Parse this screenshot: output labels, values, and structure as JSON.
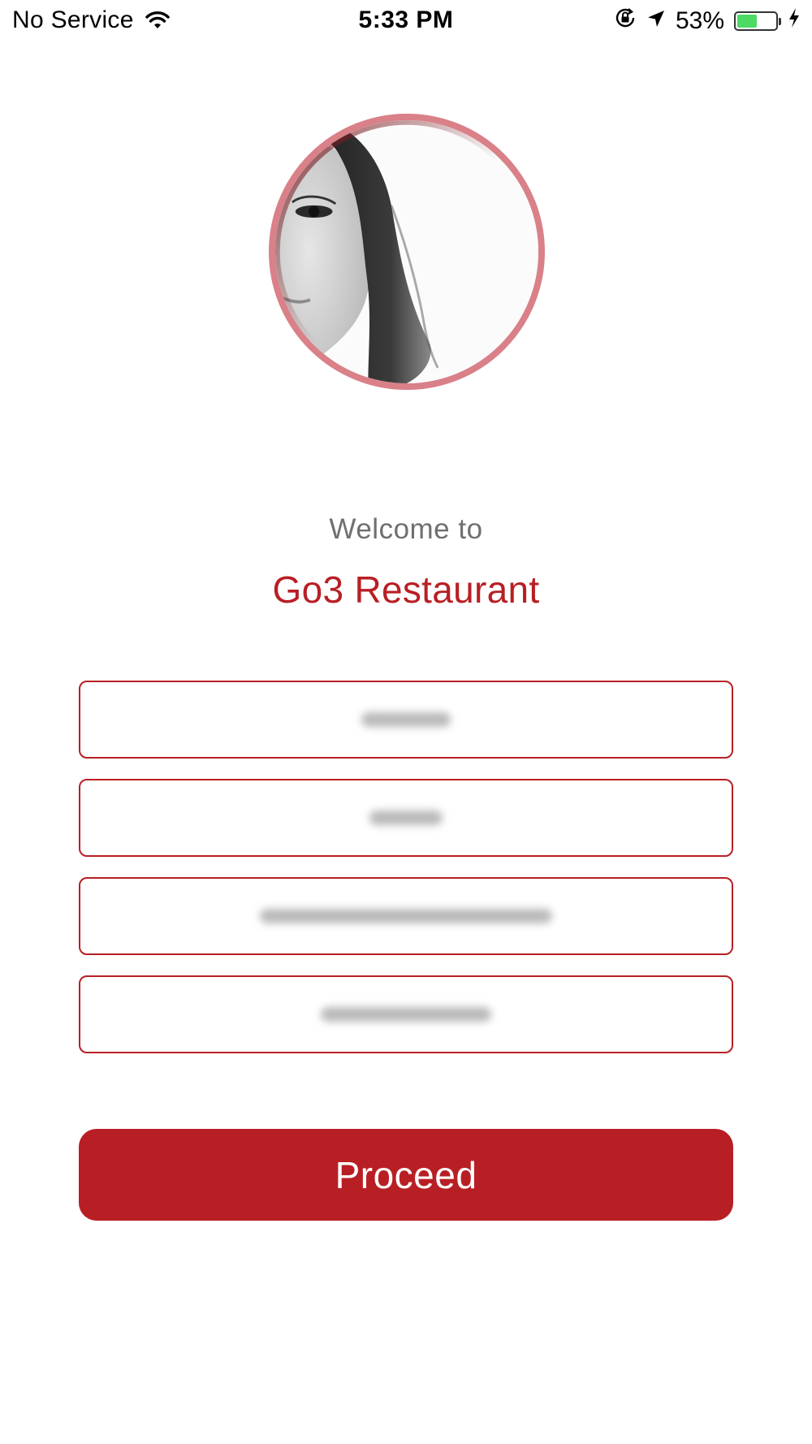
{
  "status_bar": {
    "carrier": "No Service",
    "time": "5:33 PM",
    "battery_percent": "53%",
    "battery_level": 0.53,
    "battery_color": "#4cd964",
    "icons": [
      "wifi-icon",
      "orientation-lock-icon",
      "location-arrow-icon",
      "battery-icon",
      "charging-bolt-icon"
    ]
  },
  "profile": {
    "avatar_icon": "profile-photo",
    "ring_color": "#d98088"
  },
  "welcome": {
    "line1": "Welcome to",
    "restaurant_name": "Go3 Restaurant"
  },
  "form": {
    "fields": [
      {
        "value": ""
      },
      {
        "value": ""
      },
      {
        "value": ""
      },
      {
        "value": ""
      }
    ],
    "border_color": "#b81f24"
  },
  "actions": {
    "proceed_label": "Proceed",
    "button_color": "#b81f24"
  }
}
